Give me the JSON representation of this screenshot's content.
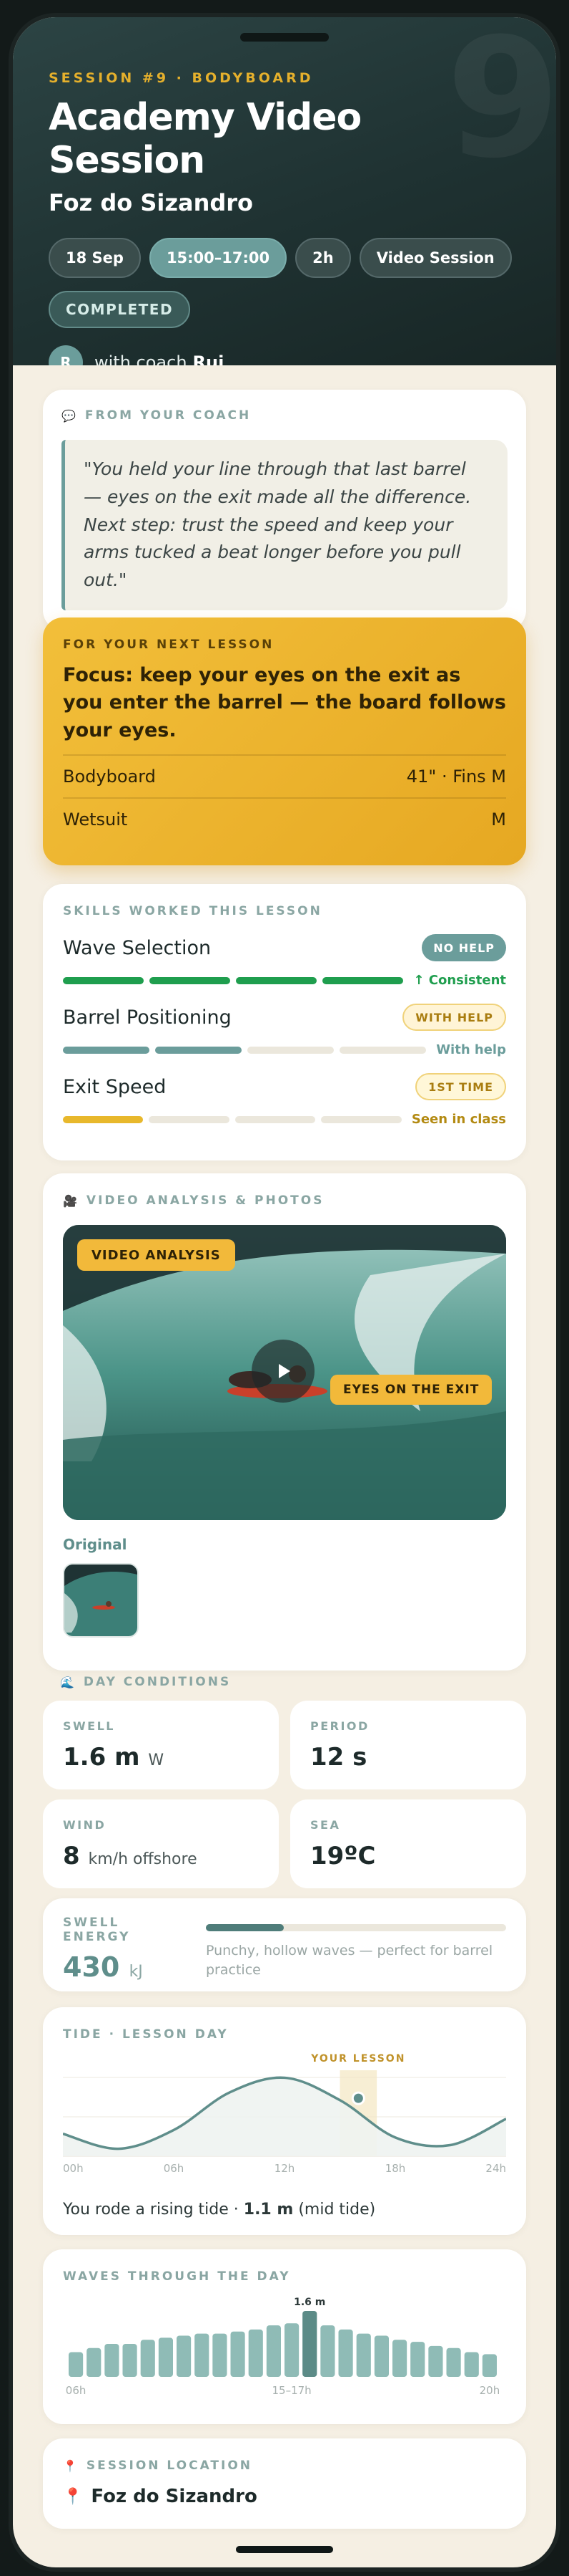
{
  "header": {
    "eyebrow": "SESSION #9 · BODYBOARD",
    "big_number": "9",
    "title": "Academy Video Session",
    "subtitle": "Foz do Sizandro",
    "pills": [
      "18 Sep",
      "15:00–17:00",
      "2h",
      "Video Session"
    ],
    "status": "COMPLETED",
    "coach_initial": "R",
    "coach_prefix": "with coach",
    "coach_name": "Rui"
  },
  "coach_note": {
    "label": "FROM YOUR COACH",
    "quote": "\"You held your line through that last barrel — eyes on the exit made all the difference. Next step: trust the speed and keep your arms tucked a beat longer before you pull out.\""
  },
  "next_lesson": {
    "eyebrow": "FOR YOUR NEXT LESSON",
    "focus": "Focus: keep your eyes on the exit as you enter the barrel — the board follows your eyes.",
    "rows": [
      {
        "label": "Bodyboard",
        "value": "41\" · Fins M"
      },
      {
        "label": "Wetsuit",
        "value": "M"
      }
    ]
  },
  "skills": {
    "label": "SKILLS WORKED THIS LESSON",
    "items": [
      {
        "name": "Wave Selection",
        "badge": "NO HELP",
        "progress": 4,
        "total": 4,
        "note": "↑ Consistent",
        "color": "#1f9e4e"
      },
      {
        "name": "Barrel Positioning",
        "badge": "WITH HELP",
        "progress": 2,
        "total": 4,
        "note": "With help",
        "color": "#6b9d9b"
      },
      {
        "name": "Exit Speed",
        "badge": "1ST TIME",
        "progress": 1,
        "total": 4,
        "note": "Seen in class",
        "color": "#e8b82c"
      }
    ]
  },
  "media": {
    "label": "VIDEO ANALYSIS & PHOTOS",
    "chip": "VIDEO ANALYSIS",
    "tag": "EYES ON THE EXIT",
    "original_label": "Original"
  },
  "conditions": {
    "label": "DAY CONDITIONS",
    "swell": {
      "k": "SWELL",
      "v": "1.6 m",
      "u": "W"
    },
    "period": {
      "k": "PERIOD",
      "v": "12 s"
    },
    "wind": {
      "k": "WIND",
      "v": "8",
      "u": "km/h offshore"
    },
    "sea": {
      "k": "SEA",
      "v": "19ºC"
    },
    "energy": {
      "k": "SWELL ENERGY",
      "v": "430",
      "u": "kJ",
      "desc": "Punchy, hollow waves — perfect for barrel practice",
      "level": 0.26
    }
  },
  "tide": {
    "label": "TIDE · LESSON DAY",
    "marker": "YOUR LESSON",
    "ticks": [
      "00h",
      "06h",
      "12h",
      "18h",
      "24h"
    ],
    "summary_prefix": "You rode a rising tide · ",
    "summary_value": "1.1 m",
    "summary_suffix": " (mid tide)"
  },
  "waves": {
    "label": "WAVES THROUGH THE DAY",
    "peak_label": "1.6 m",
    "ticks": [
      "06h",
      "15–17h",
      "20h"
    ]
  },
  "chart_data": [
    {
      "type": "area",
      "title": "TIDE · LESSON DAY",
      "x": [
        0,
        3,
        6,
        9,
        12,
        15,
        18,
        21,
        24
      ],
      "x_ticks": [
        "00h",
        "06h",
        "12h",
        "18h",
        "24h"
      ],
      "values": [
        0.6,
        0.2,
        0.7,
        1.7,
        2.1,
        1.5,
        0.5,
        0.3,
        1.0
      ],
      "highlight": {
        "from": 15,
        "to": 17,
        "label": "YOUR LESSON"
      },
      "grid": true
    },
    {
      "type": "bar",
      "title": "WAVES THROUGH THE DAY",
      "categories": [
        "06h",
        "",
        "",
        "",
        "",
        "",
        "",
        "",
        "",
        "",
        "",
        "",
        "15–17h",
        "",
        "",
        "",
        "",
        "",
        "",
        "",
        "",
        "",
        "",
        "20h"
      ],
      "values": [
        0.6,
        0.7,
        0.8,
        0.8,
        0.9,
        0.95,
        1.0,
        1.05,
        1.05,
        1.1,
        1.15,
        1.25,
        1.3,
        1.6,
        1.25,
        1.15,
        1.05,
        1.0,
        0.9,
        0.85,
        0.75,
        0.7,
        0.6,
        0.55
      ],
      "highlight_index": 13,
      "peak_label": "1.6 m"
    }
  ],
  "location": {
    "label": "SESSION LOCATION",
    "name": "Foz do Sizandro"
  },
  "colors": {
    "accent_gold": "#e6a822",
    "teal": "#6b9d9b",
    "green": "#1f9e4e"
  }
}
